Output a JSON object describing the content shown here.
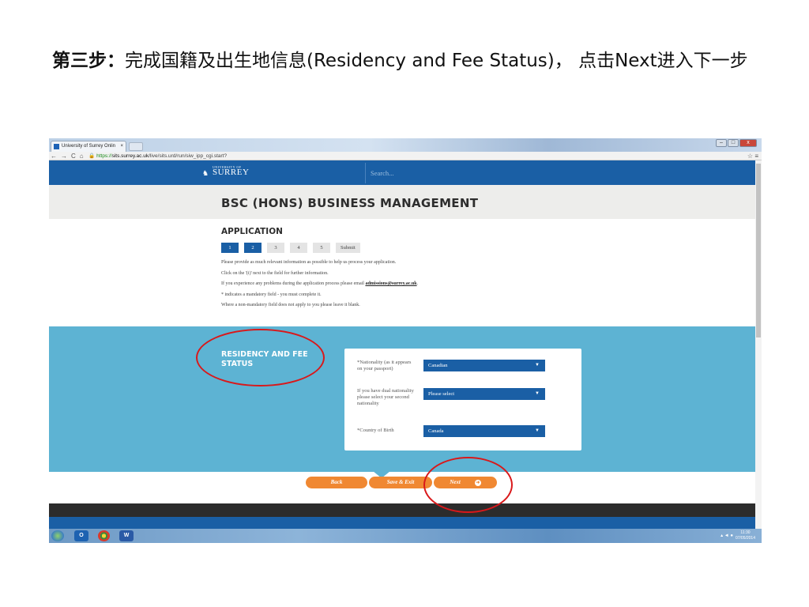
{
  "slide": {
    "title_bold": "第三步：",
    "title_rest": "完成国籍及出生地信息(Residency and Fee Status)， 点击Next进入下一步"
  },
  "browser": {
    "tab_title": "University of Surrey Onlin",
    "tab_close": "×",
    "url_prefix": "https://",
    "url_host": "sits.surrey.ac.uk",
    "url_path": "/live/sits.urd/run/siw_ipp_cgi.start?",
    "window_buttons": [
      "–",
      "□",
      "x"
    ]
  },
  "site": {
    "logo_small": "UNIVERSITY OF",
    "logo": "SURREY",
    "search_placeholder": "Search..."
  },
  "course": {
    "title": "BSC (HONS) BUSINESS MANAGEMENT"
  },
  "application": {
    "heading": "APPLICATION",
    "steps": [
      "1",
      "2",
      "3",
      "4",
      "5",
      "Submit"
    ],
    "info": [
      "Please provide as much relevant information as possible to help us process your application.",
      "Click on the '(i)' next to the field for further information.",
      "If you experience any problems during the application process please email",
      "* indicates a mandatory field - you must complete it.",
      "Where a non-mandatory field does not apply to you please leave it blank."
    ],
    "email": "admissions@surrey.ac.uk"
  },
  "form": {
    "section_title": "RESIDENCY AND FEE STATUS",
    "fields": [
      {
        "label": "*Nationality (as it appears on your passport)",
        "value": "Canadian"
      },
      {
        "label": "If you have dual nationality please select your second nationality",
        "value": "Please select"
      },
      {
        "label": "*Country of Birth",
        "value": "Canada"
      }
    ]
  },
  "actions": {
    "back": "Back",
    "save_exit": "Save & Exit",
    "next": "Next"
  },
  "taskbar": {
    "time": "11:30",
    "date": "07/05/2014"
  },
  "colors": {
    "header_blue": "#1a5fa5",
    "form_band": "#5db3d3",
    "button_orange": "#f08832",
    "annotation_red": "#d9181a"
  }
}
